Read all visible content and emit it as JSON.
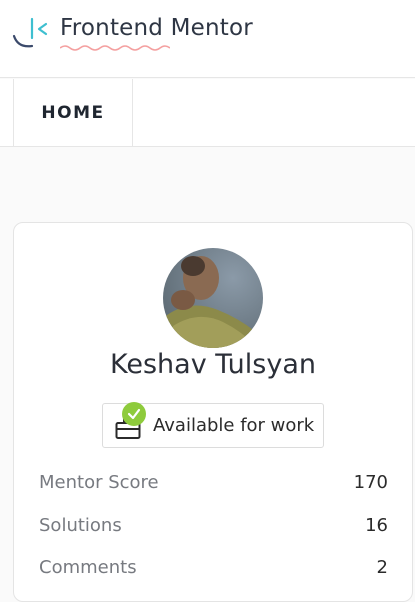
{
  "header": {
    "brand": "Frontend Mentor"
  },
  "nav": {
    "home_label": "HOME"
  },
  "profile": {
    "name": "Keshav Tulsyan",
    "availability": "Available for work",
    "stats": [
      {
        "label": "Mentor Score",
        "value": "170"
      },
      {
        "label": "Solutions",
        "value": "16"
      },
      {
        "label": "Comments",
        "value": "2"
      }
    ]
  },
  "colors": {
    "brand_accent": "#3ebfd0",
    "squiggle": "#f4a0a0",
    "available_check": "#8ecb3c"
  },
  "icons": [
    "frontend-mentor-logo-icon",
    "briefcase-icon",
    "check-icon"
  ]
}
